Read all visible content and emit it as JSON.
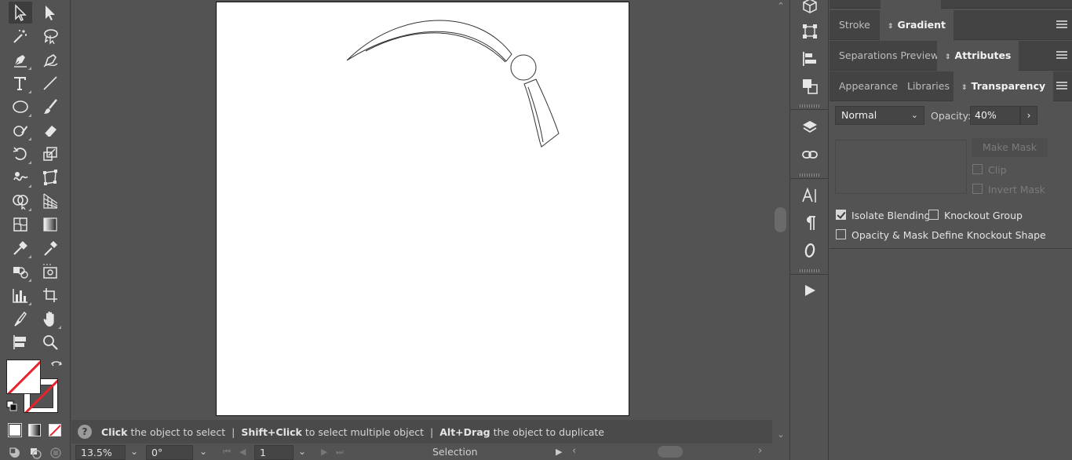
{
  "toolbar": {
    "tools": [
      "selection-tool",
      "direct-selection-tool",
      "magic-wand-tool",
      "lasso-tool",
      "pen-tool",
      "curvature-tool",
      "type-tool",
      "line-segment-tool",
      "ellipse-tool",
      "paintbrush-tool",
      "shaper-tool",
      "eraser-tool",
      "rotate-tool",
      "scale-tool",
      "warp-tool",
      "free-transform-tool",
      "shape-builder-tool",
      "perspective-grid-tool",
      "mesh-tool",
      "gradient-tool",
      "eyedropper-tool",
      "eyedropper-sample-tool",
      "symbol-sprayer-tool",
      "artboard-image-tool",
      "column-graph-tool",
      "artboard-tool",
      "slice-tool",
      "hand-tool",
      "print-tiling-tool",
      "zoom-tool"
    ],
    "active_tool": "selection-tool",
    "drawing_modes": [
      "fill-mode",
      "gradient-mode",
      "none-mode"
    ]
  },
  "status": {
    "help_icon": "?",
    "hint1_bold": "Click",
    "hint1_text": "the object to select",
    "sep": "|",
    "hint2_bold": "Shift+Click",
    "hint2_text": "to select multiple object",
    "hint3_bold": "Alt+Drag",
    "hint3_text": "the object to duplicate"
  },
  "bottombar": {
    "zoom": "13.5%",
    "rotation": "0°",
    "artboard_number": "1",
    "current_tool": "Selection"
  },
  "panel": {
    "row1_tabs": [
      "Stroke",
      "Gradient"
    ],
    "row1_active": "Gradient",
    "row2_tabs": [
      "Separations Preview",
      "Attributes"
    ],
    "row2_active": "Attributes",
    "row3_tabs": [
      "Appearance",
      "Libraries",
      "Transparency"
    ],
    "row3_active": "Transparency",
    "blend_mode": "Normal",
    "opacity_label": "Opacity:",
    "opacity_value": "40%",
    "make_mask_label": "Make Mask",
    "clip_label": "Clip",
    "invert_mask_label": "Invert Mask",
    "isolate_blending_label": "Isolate Blending",
    "isolate_blending_checked": true,
    "knockout_group_label": "Knockout Group",
    "knockout_group_checked": false,
    "opacity_mask_knockout_label": "Opacity & Mask Define Knockout Shape",
    "opacity_mask_knockout_checked": false
  },
  "dock": {
    "icons": [
      "3d-cube-icon",
      "transform-icon",
      "align-icon",
      "pathfinder-icon",
      "layers-icon",
      "links-icon",
      "character-icon",
      "paragraph-icon",
      "opentype-icon",
      "actions-play-icon"
    ]
  },
  "colors": {
    "ui_background": "#535353",
    "artboard": "#ffffff",
    "none_slash": "#e8222a"
  }
}
